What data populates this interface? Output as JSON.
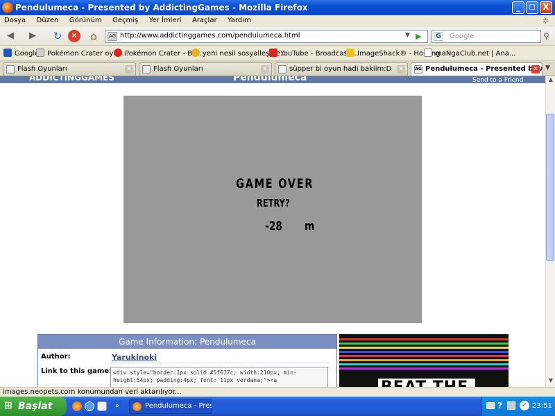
{
  "window": {
    "title": "Pendulumeca - Presented by AddictingGames - Mozilla Firefox",
    "controls": [
      "_",
      "□",
      "X"
    ]
  },
  "menu": [
    "Dosya",
    "Düzen",
    "Görünüm",
    "Geçmiş",
    "Yer İmleri",
    "Araçlar",
    "Yardım"
  ],
  "nav": {
    "url": "http://www.addictinggames.com/pendulumeca.html",
    "search_placeholder": "Google",
    "favicon": "AG"
  },
  "bookmarks": [
    {
      "label": "Google",
      "icon": "google-g-icon",
      "color": "#2255cc"
    },
    {
      "label": "Pokémon Crater oyun...",
      "icon": "page-icon",
      "color": "#cccccc"
    },
    {
      "label": "Pokémon Crater - Bat...",
      "icon": "pokeball-icon",
      "color": "#dd2222"
    },
    {
      "label": "yeni nesil sosyalleşme...",
      "icon": "link-icon",
      "color": "#e8b020"
    },
    {
      "label": "YouTube - Broadcast ...",
      "icon": "youtube-icon",
      "color": "#dd2222"
    },
    {
      "label": "ImageShack® - Hosting",
      "icon": "imageshack-icon",
      "color": "#f0c020"
    },
    {
      "label": "maNgaClub.net | Ana...",
      "icon": "page-icon",
      "color": "#ffffff"
    }
  ],
  "tabs": [
    {
      "label": "Flash Oyunları",
      "active": false
    },
    {
      "label": "Flash Oyunları",
      "active": false
    },
    {
      "label": "süpper bi oyun hadi bakiim:D",
      "active": false
    },
    {
      "label": "Pendulumeca - Presented by Add...",
      "active": true,
      "favicon": "AG"
    }
  ],
  "page": {
    "logo": "ADDICTINGGAMES",
    "title": "Pendulumeca",
    "send_to_friend": "Send to a Friend",
    "game": {
      "game_over": "GAME OVER",
      "retry": "RETRY?",
      "distance_value": "-28",
      "distance_unit": "m",
      "bg_color": "#999999"
    },
    "info": {
      "heading": "Game Information: Pendulumeca",
      "author_label": "Author:",
      "author_value": "Yarukinoki",
      "link_label": "Link to this game:",
      "link_code": "<div style=\"border:1px solid #5f677c; width:210px; min-height:54px; padding:4px; font: 11px verdana;\"><a"
    },
    "ad_text": "BEAT THE"
  },
  "status": "images.neopets.com konumundan veri aktarılıyor...",
  "taskbar": {
    "start": "Başlat",
    "item": "Pendulumeca - Prese...",
    "clock": "23:51"
  }
}
